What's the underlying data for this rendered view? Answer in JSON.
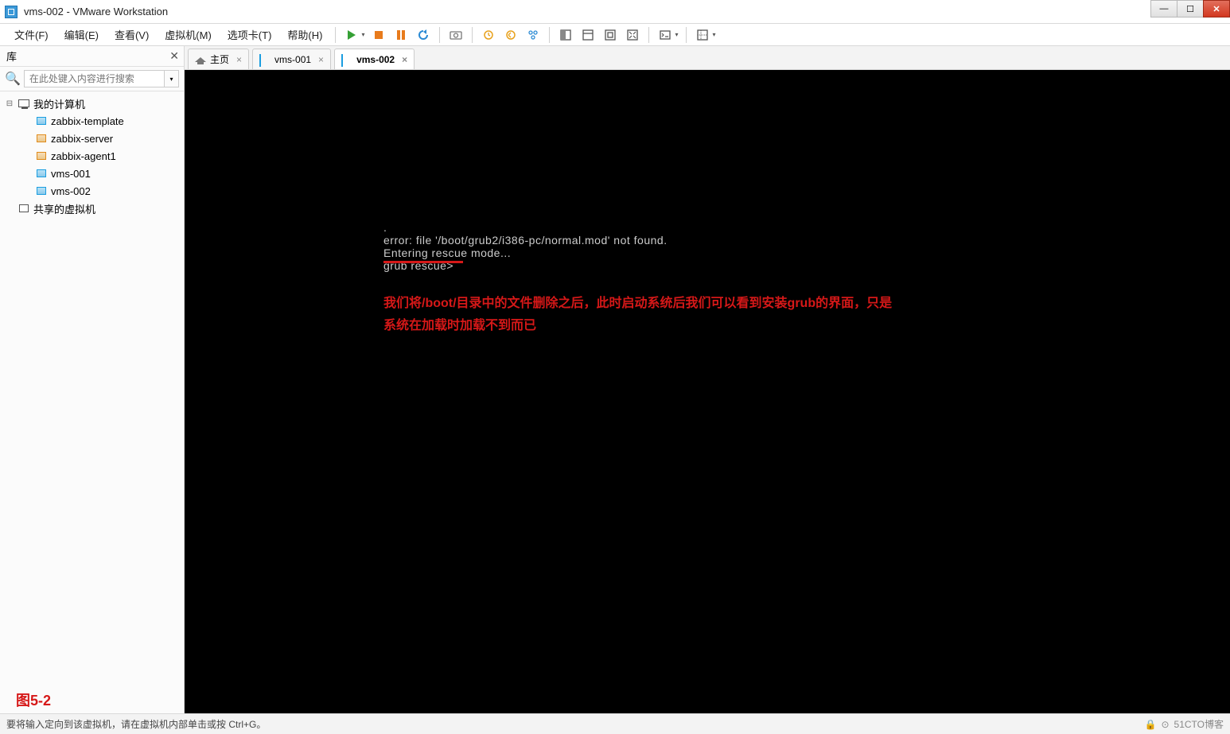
{
  "title": "vms-002 - VMware Workstation",
  "menu": {
    "items": [
      "文件(F)",
      "编辑(E)",
      "查看(V)",
      "虚拟机(M)",
      "选项卡(T)",
      "帮助(H)"
    ]
  },
  "sidebar": {
    "header": "库",
    "search_placeholder": "在此处键入内容进行搜索",
    "root": "我的计算机",
    "items": [
      {
        "label": "zabbix-template",
        "style": "blue"
      },
      {
        "label": "zabbix-server",
        "style": "orange"
      },
      {
        "label": "zabbix-agent1",
        "style": "orange"
      },
      {
        "label": "vms-001",
        "style": "blue"
      },
      {
        "label": "vms-002",
        "style": "blue"
      }
    ],
    "shared": "共享的虚拟机"
  },
  "tabs": [
    {
      "label": "主页",
      "type": "home",
      "active": false
    },
    {
      "label": "vms-001",
      "type": "vm",
      "active": false
    },
    {
      "label": "vms-002",
      "type": "vm",
      "active": true
    }
  ],
  "console": {
    "dot": ".",
    "line1": "error: file '/boot/grub2/i386-pc/normal.mod' not found.",
    "line2": "Entering rescue mode...",
    "line3": "grub rescue>",
    "annotation_l1": "我们将/boot/目录中的文件删除之后，此时启动系统后我们可以看到安装grub的界面，只是",
    "annotation_l2": "系统在加载时加载不到而已"
  },
  "figure_label": "图5-2",
  "statusbar": {
    "text": "要将输入定向到该虚拟机，请在虚拟机内部单击或按 Ctrl+G。",
    "watermark": "51CTO博客"
  }
}
